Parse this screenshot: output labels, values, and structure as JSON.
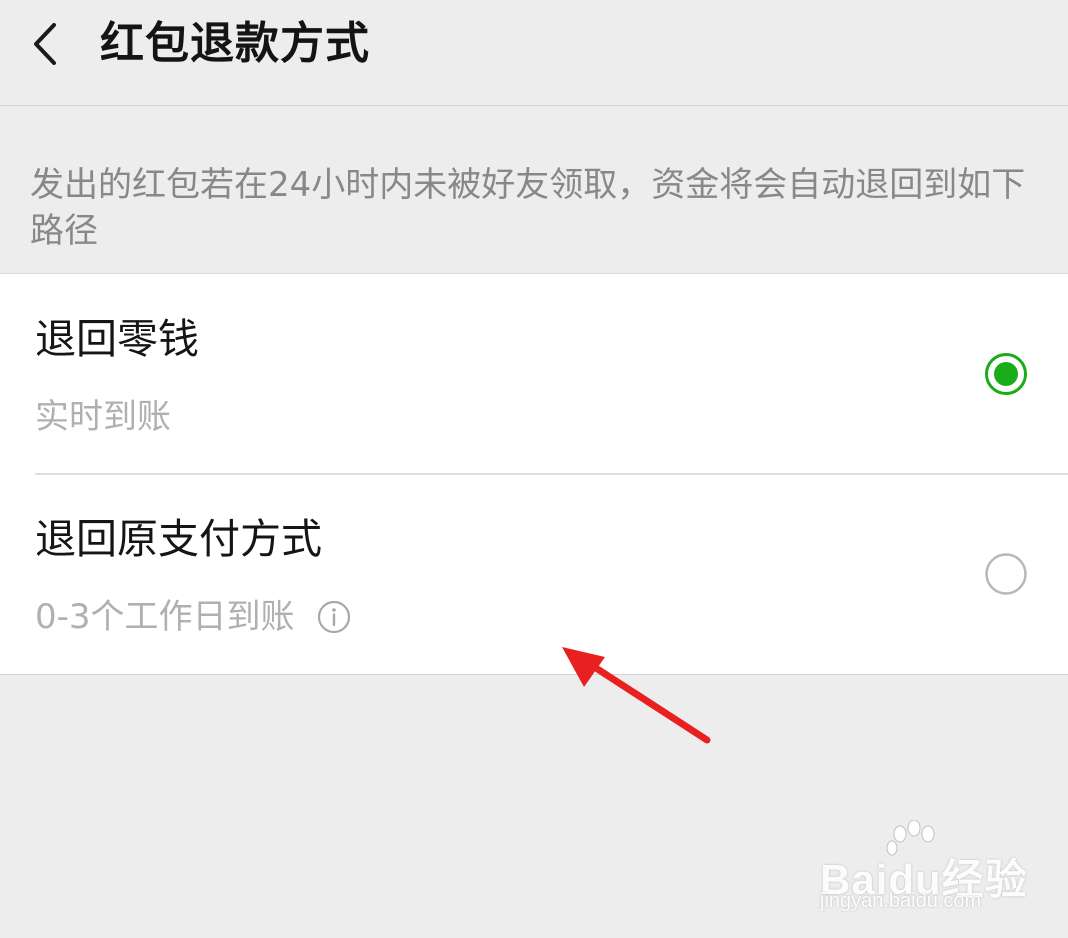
{
  "header": {
    "back_icon": "chevron-left-icon",
    "title": "红包退款方式"
  },
  "description": "发出的红包若在24小时内未被好友领取，资金将会自动退回到如下路径",
  "options": [
    {
      "title": "退回零钱",
      "subtitle": "实时到账",
      "selected": true
    },
    {
      "title": "退回原支付方式",
      "subtitle": "0-3个工作日到账",
      "info_icon": "info-icon",
      "selected": false
    }
  ],
  "colors": {
    "accent": "#1aad19",
    "annotation_arrow": "#e8201f",
    "background": "#ededed"
  },
  "watermark": {
    "brand": "Baidu经验",
    "url": "jingyan.baidu.com"
  }
}
